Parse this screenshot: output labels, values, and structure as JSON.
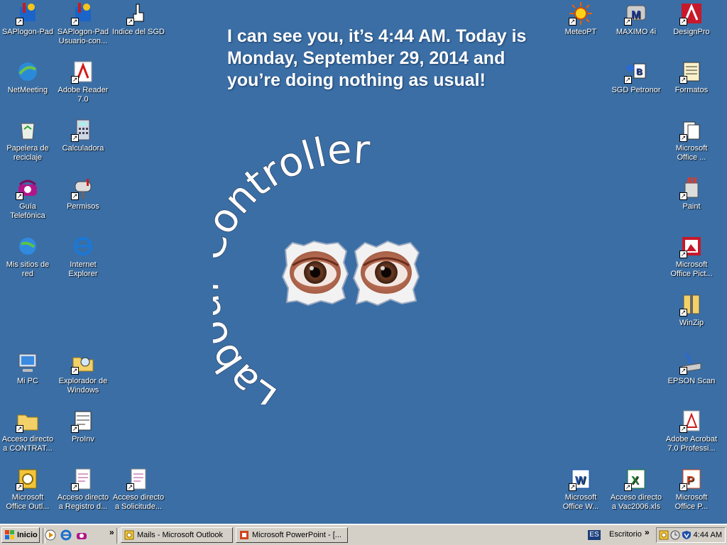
{
  "desktop": {
    "message": "I can see you, it’s 4:44 AM. Today is Monday, September 29, 2014 and you’re doing nothing as usual!",
    "wallpaper_arc_text": "Labour Controller",
    "icons_left": [
      {
        "label": "SAPlogon-Pad",
        "icon": "sap-logon-icon"
      },
      {
        "label": "SAPlogon-Pad Usuario-con...",
        "icon": "sap-logon-user-icon"
      },
      {
        "label": "Indice del SGD",
        "icon": "pointing-hand-icon"
      },
      {
        "label": "NetMeeting",
        "icon": "netmeeting-icon"
      },
      {
        "label": "Adobe Reader 7.0",
        "icon": "adobe-reader-icon"
      },
      {
        "label": "Papelera de reciclaje",
        "icon": "recycle-bin-icon"
      },
      {
        "label": "Calculadora",
        "icon": "calculator-icon"
      },
      {
        "label": "Guía Telefónica",
        "icon": "telephone-icon"
      },
      {
        "label": "Permisos",
        "icon": "mailbox-icon"
      },
      {
        "label": "Mis sitios de red",
        "icon": "network-places-icon"
      },
      {
        "label": "Internet Explorer",
        "icon": "internet-explorer-icon"
      },
      {
        "label": "Mi PC",
        "icon": "my-computer-icon"
      },
      {
        "label": "Explorador de Windows",
        "icon": "windows-explorer-icon"
      },
      {
        "label": "Acceso directo a CONTRAT...",
        "icon": "folder-shortcut-icon"
      },
      {
        "label": "ProInv",
        "icon": "proinv-icon"
      },
      {
        "label": "Microsoft Office Outl...",
        "icon": "outlook-icon"
      },
      {
        "label": "Acceso directo a Registro d...",
        "icon": "document-shortcut-icon"
      },
      {
        "label": "Acceso directo a Solicitude...",
        "icon": "document-shortcut-icon"
      }
    ],
    "icons_right": [
      {
        "label": "MeteoPT",
        "icon": "sun-icon"
      },
      {
        "label": "MAXIMO 4i",
        "icon": "maximo-icon"
      },
      {
        "label": "DesignPro",
        "icon": "designpro-icon"
      },
      {
        "label": "SGD Petronor",
        "icon": "sgd-petronor-icon"
      },
      {
        "label": "Formatos",
        "icon": "forms-icon"
      },
      {
        "label": "Microsoft Office ...",
        "icon": "office-icon"
      },
      {
        "label": "Paint",
        "icon": "paint-icon"
      },
      {
        "label": "Microsoft Office Pict...",
        "icon": "office-picture-icon"
      },
      {
        "label": "WinZip",
        "icon": "winzip-icon"
      },
      {
        "label": "EPSON Scan",
        "icon": "scanner-icon"
      },
      {
        "label": "Adobe Acrobat 7.0 Professi...",
        "icon": "acrobat-icon"
      },
      {
        "label": "Microsoft Office W...",
        "icon": "word-icon"
      },
      {
        "label": "Acceso directo a Vac2006.xls",
        "icon": "excel-icon"
      },
      {
        "label": "Microsoft Office P...",
        "icon": "powerpoint-icon"
      }
    ]
  },
  "taskbar": {
    "start_label": "Inicio",
    "chevron": "»",
    "tasks": [
      {
        "label": "Mails - Microsoft Outlook",
        "icon": "outlook-icon"
      },
      {
        "label": "Microsoft PowerPoint - [...",
        "icon": "powerpoint-icon"
      }
    ],
    "language": "ES",
    "desktop_toolbar_label": "Escritorio",
    "clock": "4:44 AM"
  },
  "colors": {
    "desktop_bg": "#3a6ea5",
    "taskbar_bg": "#d4d0c8"
  }
}
